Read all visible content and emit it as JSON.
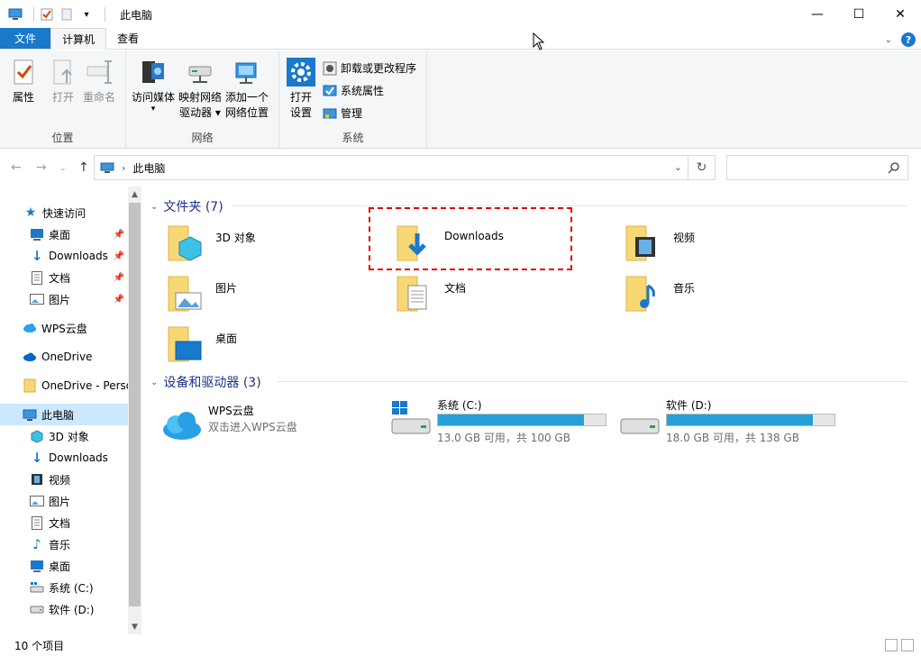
{
  "window": {
    "title": "此电脑"
  },
  "window_controls": {
    "minimize": "—",
    "maximize": "☐",
    "close": "✕"
  },
  "tabs": [
    {
      "label": "文件"
    },
    {
      "label": "计算机"
    },
    {
      "label": "查看"
    }
  ],
  "ribbon": {
    "location": {
      "label": "位置",
      "properties": "属性",
      "open": "打开",
      "rename": "重命名"
    },
    "network": {
      "label": "网络",
      "media_l1": "访问媒体",
      "map_l1": "映射网络",
      "map_l2": "驱动器 ▾",
      "add_l1": "添加一个",
      "add_l2": "网络位置"
    },
    "system": {
      "label": "系统",
      "settings_l1": "打开",
      "settings_l2": "设置",
      "uninstall": "卸载或更改程序",
      "sysprops": "系统属性",
      "manage": "管理"
    }
  },
  "address": {
    "path": "此电脑",
    "search_placeholder": ""
  },
  "sidebar": {
    "items": [
      {
        "label": "快速访问"
      },
      {
        "label": "桌面"
      },
      {
        "label": "Downloads"
      },
      {
        "label": "文档"
      },
      {
        "label": "图片"
      },
      {
        "label": "WPS云盘"
      },
      {
        "label": "OneDrive"
      },
      {
        "label": "OneDrive - Personal"
      },
      {
        "label": "此电脑"
      },
      {
        "label": "3D 对象"
      },
      {
        "label": "Downloads"
      },
      {
        "label": "视频"
      },
      {
        "label": "图片"
      },
      {
        "label": "文档"
      },
      {
        "label": "音乐"
      },
      {
        "label": "桌面"
      },
      {
        "label": "系统 (C:)"
      },
      {
        "label": "软件 (D:)"
      }
    ]
  },
  "main": {
    "folders_header": "文件夹 (7)",
    "folders": [
      {
        "name": "3D 对象"
      },
      {
        "name": "Downloads"
      },
      {
        "name": "视频"
      },
      {
        "name": "图片"
      },
      {
        "name": "文档"
      },
      {
        "name": "音乐"
      },
      {
        "name": "桌面"
      }
    ],
    "devices_header": "设备和驱动器 (3)",
    "wps": {
      "name": "WPS云盘",
      "subtitle": "双击进入WPS云盘"
    },
    "drives": [
      {
        "name": "系统 (C:)",
        "info": "13.0 GB 可用，共 100 GB",
        "used_fraction": 0.87
      },
      {
        "name": "软件 (D:)",
        "info": "18.0 GB 可用，共 138 GB",
        "used_fraction": 0.87
      }
    ]
  },
  "status": {
    "count": "10 个项目"
  },
  "colors": {
    "accent": "#1979ca",
    "drive_bar": "#26a0da",
    "highlight": "#e00000",
    "folder": "#f8d775"
  }
}
